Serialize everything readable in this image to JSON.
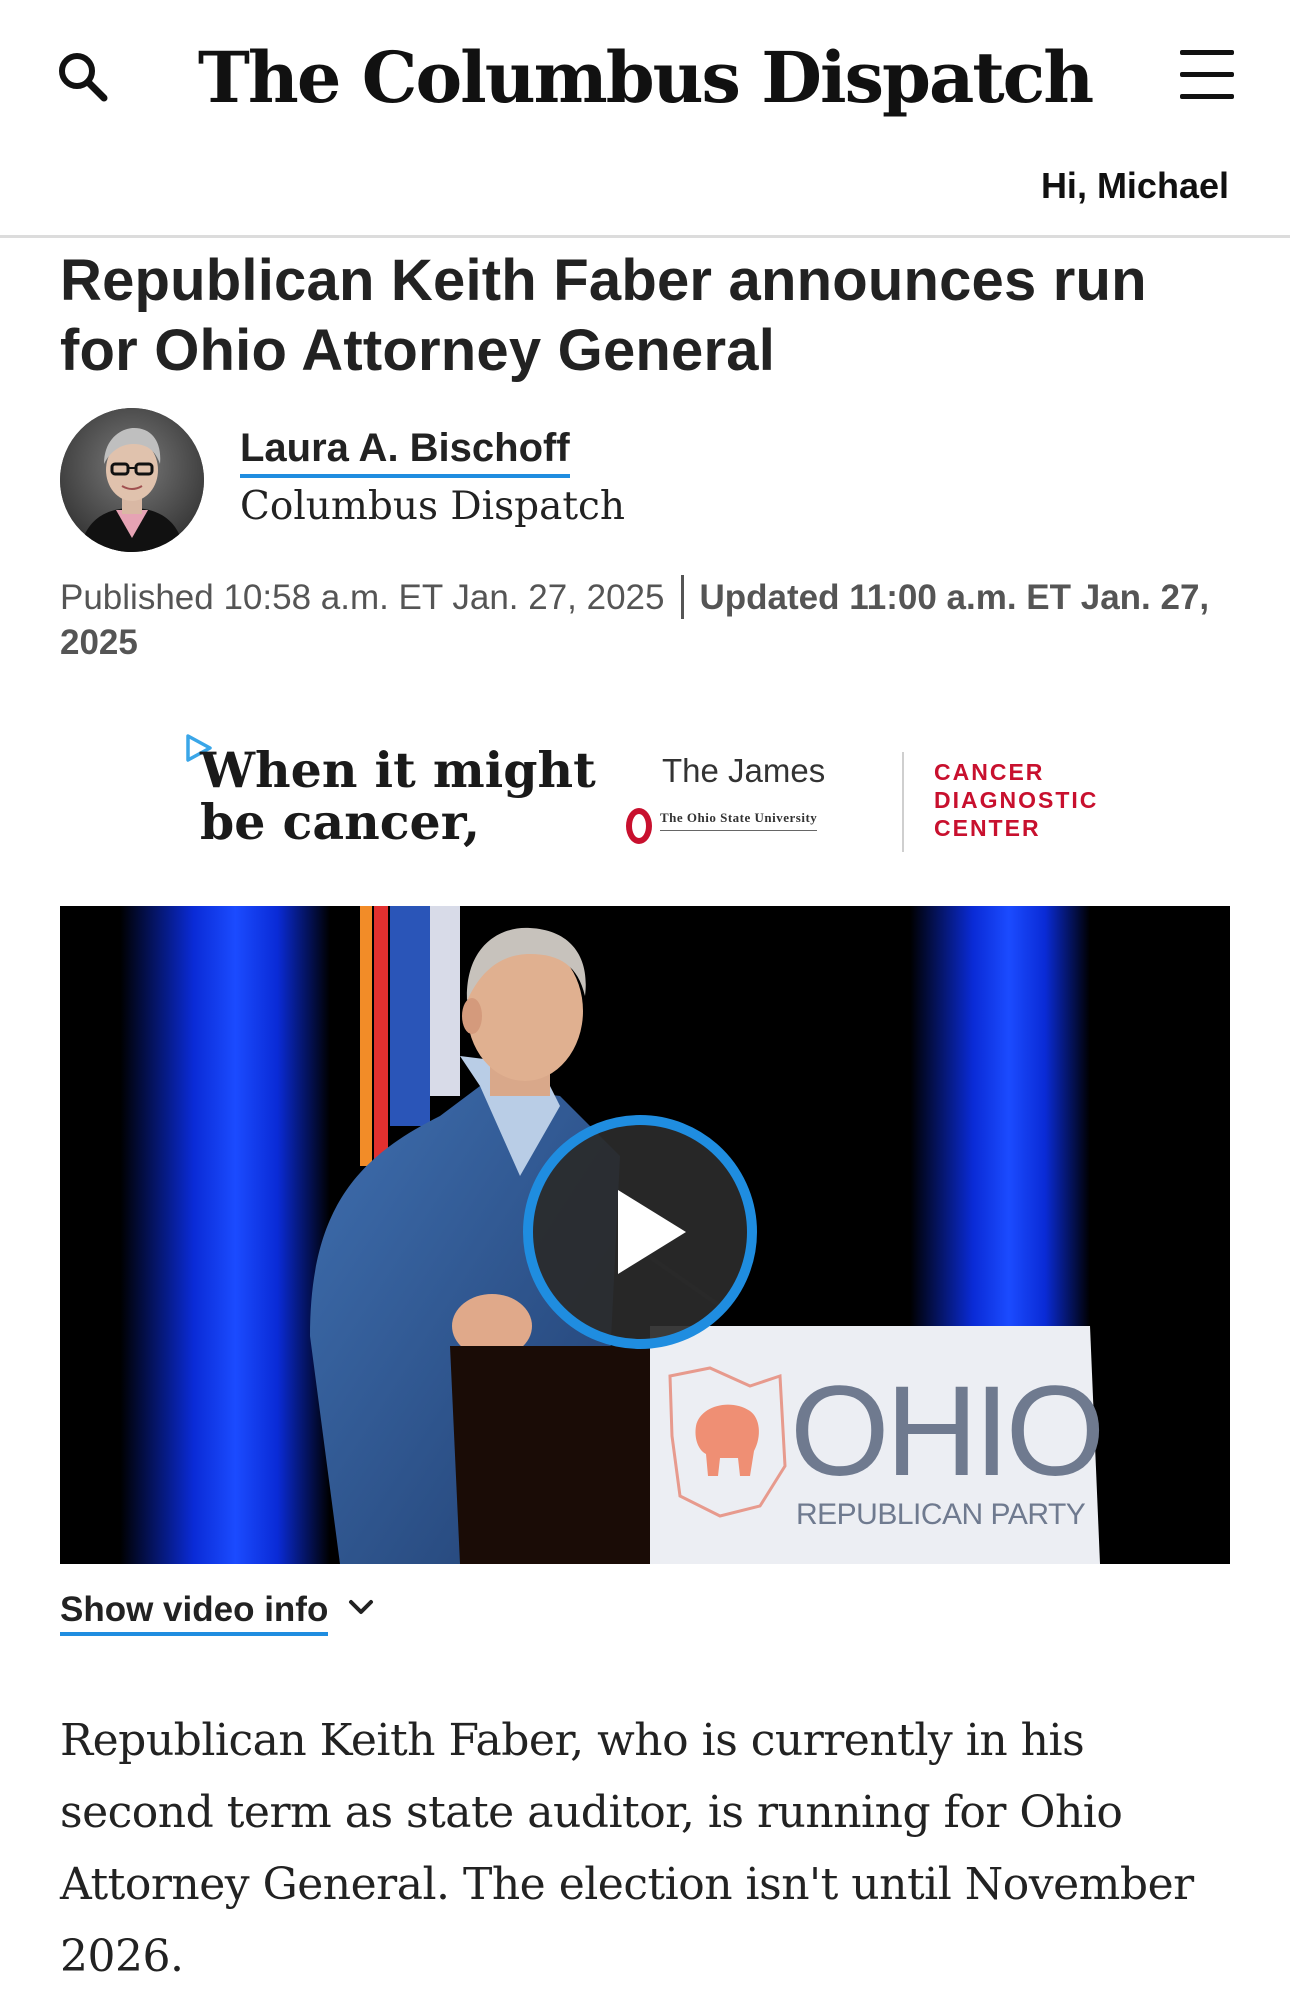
{
  "header": {
    "masthead": "The Columbus Dispatch",
    "greeting": "Hi, Michael",
    "search_icon": "search-icon",
    "menu_icon": "hamburger-menu-icon"
  },
  "article": {
    "headline": "Republican Keith Faber announces run for Ohio Attorney General",
    "author": {
      "name": "Laura A. Bischoff",
      "outlet": "Columbus Dispatch"
    },
    "published": "Published 10:58 a.m. ET Jan. 27, 2025",
    "updated": "Updated 11:00 a.m. ET Jan. 27, 2025",
    "body": "Republican Keith Faber, who is currently in his second term as state auditor, is running for Ohio Attorney General. The election isn't until November 2026."
  },
  "ad": {
    "tagline_line1": "When it might",
    "tagline_line2": "be cancer,",
    "brand": "The James",
    "university": "The Ohio State University",
    "cdc_line1": "CANCER",
    "cdc_line2": "DIAGNOSTIC",
    "cdc_line3": "CENTER",
    "accent_color": "#c8102e"
  },
  "video": {
    "sign_text": "OHIO",
    "sign_subtext": "REPUBLICAN PARTY",
    "play_icon": "play-icon",
    "show_info_label": "Show video info",
    "chevron_icon": "chevron-down-icon"
  },
  "colors": {
    "link_underline": "#1f8de0",
    "play_ring": "#1f8de0",
    "divider": "#dcdcdc"
  }
}
